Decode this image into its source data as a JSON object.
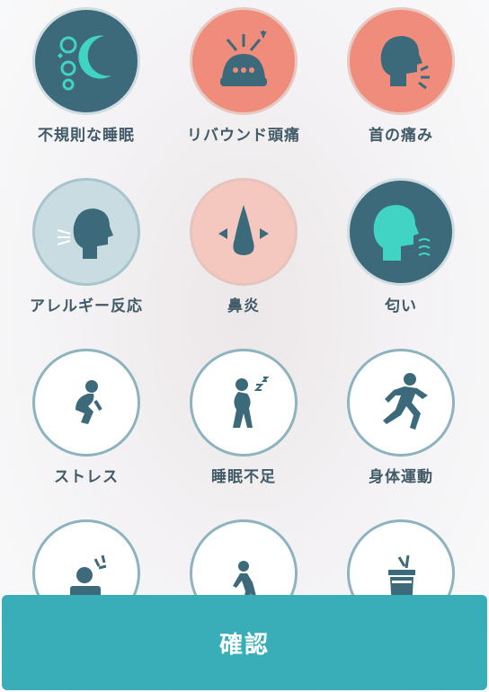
{
  "symptoms": [
    {
      "label": "不規則な睡眠",
      "icon": "moon-stars-icon"
    },
    {
      "label": "リバウンド頭痛",
      "icon": "headache-icon"
    },
    {
      "label": "首の痛み",
      "icon": "neck-pain-icon"
    },
    {
      "label": "アレルギー反応",
      "icon": "allergy-icon"
    },
    {
      "label": "鼻炎",
      "icon": "nose-icon"
    },
    {
      "label": "匂い",
      "icon": "smell-icon"
    },
    {
      "label": "ストレス",
      "icon": "stress-icon"
    },
    {
      "label": "睡眠不足",
      "icon": "sleep-lack-icon"
    },
    {
      "label": "身体運動",
      "icon": "running-icon"
    },
    {
      "label": "",
      "icon": "screen-work-icon"
    },
    {
      "label": "",
      "icon": "bent-person-icon"
    },
    {
      "label": "",
      "icon": "drink-icon"
    }
  ],
  "confirm_button": {
    "label": "確認"
  },
  "colors": {
    "dark_teal": "#3d6a7a",
    "salmon": "#ef8c7c",
    "pale_blue": "#c9dce2",
    "pink": "#f5c8bf",
    "aqua_icon": "#41d3c3",
    "button": "#3aaeb8"
  }
}
